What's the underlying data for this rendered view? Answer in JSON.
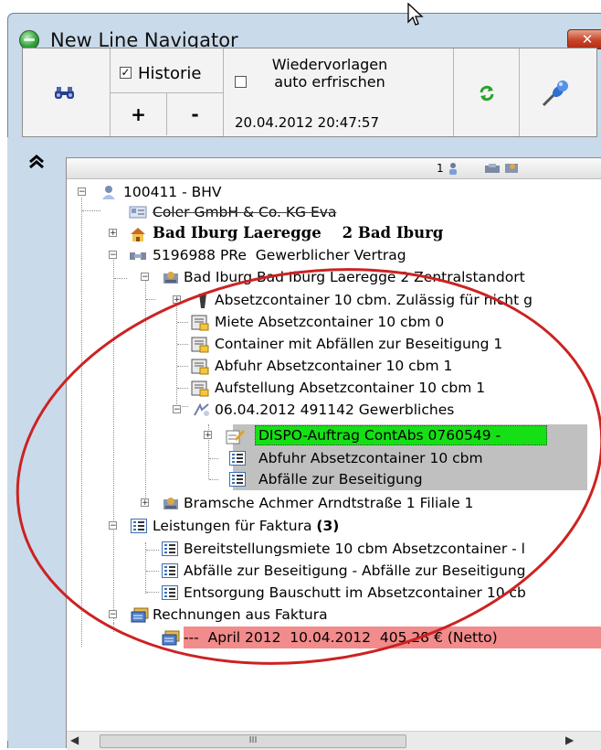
{
  "window": {
    "title": "New Line Navigator",
    "close_label": "✕"
  },
  "toolbar": {
    "historie_label": "Historie",
    "historie_checked": true,
    "plus_label": "+",
    "minus_label": "-",
    "wiedervorlagen_label": "Wiedervorlagen auto erfrischen",
    "wiedervorlagen_checked": false,
    "timestamp": "20.04.2012 20:47:57",
    "icons": [
      "binoculars-icon",
      "refresh-icon",
      "pin-icon"
    ]
  },
  "sidebar": {
    "collapse_glyph": "⌃"
  },
  "tree": {
    "header_count": "1",
    "items": [
      {
        "label": "100411 - BHV",
        "icon": "person-icon"
      },
      {
        "label": "Coler GmbH & Co. KG Eva",
        "icon": "address-card-icon"
      },
      {
        "label": "Bad Iburg Laeregge    2 Bad Iburg",
        "icon": "house-icon"
      },
      {
        "label": "5196988 PRe  Gewerblicher Vertrag",
        "icon": "handshake-icon"
      },
      {
        "label": "Bad Iburg Bad Iburg Laeregge 2 Zentralstandort",
        "icon": "site-icon"
      },
      {
        "label": "Absetzcontainer 10 cbm. Zulässig für nicht g",
        "icon": "container-icon"
      },
      {
        "label": "Miete Absetzcontainer 10 cbm 0",
        "icon": "doc-folder-icon"
      },
      {
        "label": "Container mit Abfällen zur Beseitigung 1",
        "icon": "doc-folder-icon"
      },
      {
        "label": "Abfuhr Absetzcontainer 10 cbm 1",
        "icon": "doc-folder-icon"
      },
      {
        "label": "Aufstellung Absetzcontainer 10 cbm 1",
        "icon": "doc-folder-icon"
      },
      {
        "label": "06.04.2012 491142 Gewerbliches",
        "icon": "order-icon"
      },
      {
        "label": "DISPO-Auftrag ContAbs 0760549 -",
        "icon": "edit-note-icon"
      },
      {
        "label": "Abfuhr Absetzcontainer 10 cbm",
        "icon": "list-icon"
      },
      {
        "label": "Abfälle zur Beseitigung",
        "icon": "list-icon"
      },
      {
        "label": "Bramsche Achmer Arndtstraße 1 Filiale 1",
        "icon": "site-icon"
      },
      {
        "label": "Leistungen für Faktura",
        "count": "(3)",
        "icon": "list-icon"
      },
      {
        "label": "Bereitstellungsmiete 10 cbm Absetzcontainer - l",
        "icon": "list-icon"
      },
      {
        "label": "Abfälle zur Beseitigung - Abfälle zur Beseitigung",
        "icon": "list-icon"
      },
      {
        "label": "Entsorgung Bauschutt im Absetzcontainer 10 cb",
        "icon": "list-icon"
      },
      {
        "label": "Rechnungen aus Faktura",
        "icon": "invoice-stack-icon"
      },
      {
        "label": "---  April 2012  10.04.2012  405,28 € (Netto)",
        "icon": "invoice-icon"
      }
    ]
  },
  "scrollbar": {
    "thumb_grip": "III",
    "left_arrow": "◀",
    "right_arrow": "▶"
  },
  "colors": {
    "window_frame": "#c9daea",
    "selection_green": "#15e015",
    "highlight_red": "#f28b8b",
    "highlight_gray": "#c0c0c0",
    "annotation_ellipse": "#cc2222"
  }
}
